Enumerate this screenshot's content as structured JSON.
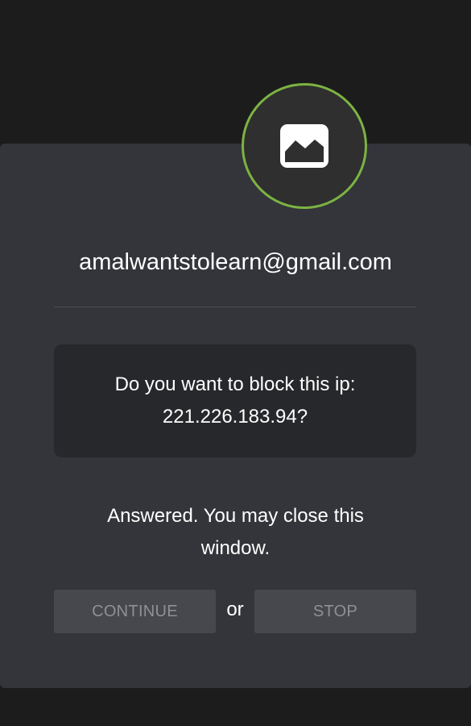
{
  "dialog": {
    "avatar_icon": "image-icon",
    "avatar_ring_color": "#7cb342",
    "email": "amalwantstolearn@gmail.com",
    "question_line1": "Do you want to block this ip:",
    "question_line2": "221.226.183.94?",
    "status_text": "Answered. You may close this window.",
    "continue_label": "CONTINUE",
    "or_label": "or",
    "stop_label": "STOP"
  }
}
